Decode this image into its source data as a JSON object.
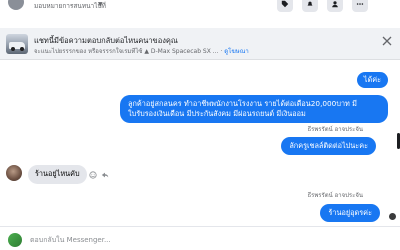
{
  "topbar": {
    "account_name": "มอบหมายการสนทนาไปที่",
    "caret": "▼",
    "buttons": [
      "tag-icon",
      "bell-icon",
      "user-icon",
      "more-icon"
    ]
  },
  "header": {
    "title": "แชทนี้มีข้อความตอบกลับต่อไหนคนาของคุณ",
    "subtitle": "จะแนะไปยรรรกของ หรือจรรรกใจเรมทีไซ้ ▲ D-Max Spacecab SX ...",
    "link": "ดูโฆษณา"
  },
  "messages": [
    {
      "id": "out1",
      "direction": "out",
      "text": "ได้ค่ะ"
    },
    {
      "id": "out2",
      "direction": "out",
      "lines": [
        "ลูกค้าอยู่สกลนคร ทำอาชีพพนักงานโรงงาน รายได้ต่อเดือน20,000บาท มี",
        "ใบรับรองเงินเดือน มีประกันสังคม มีผ่อนรถยนต์ มีเงินออม"
      ]
    },
    {
      "id": "sender1",
      "direction": "label",
      "text": "ธีรพรรัตน์ อาจประจัน"
    },
    {
      "id": "out3",
      "direction": "out",
      "text": "ลักครูเชลล์ติดต่อไปนะคะ"
    },
    {
      "id": "in1",
      "direction": "in",
      "text": "ร้านอยู่ไหนคับ"
    },
    {
      "id": "sender2",
      "direction": "label",
      "text": "ธีรพรรัตน์ อาจประจัน"
    },
    {
      "id": "out4",
      "direction": "out",
      "text": "ร้านอยู่อุดรค่ะ"
    }
  ],
  "composer": {
    "placeholder": "ตอบกลับใน Messenger..."
  },
  "colors": {
    "outgoing_bubble": "#1877f2",
    "incoming_bubble": "#e4e6eb",
    "link": "#1877f2"
  }
}
